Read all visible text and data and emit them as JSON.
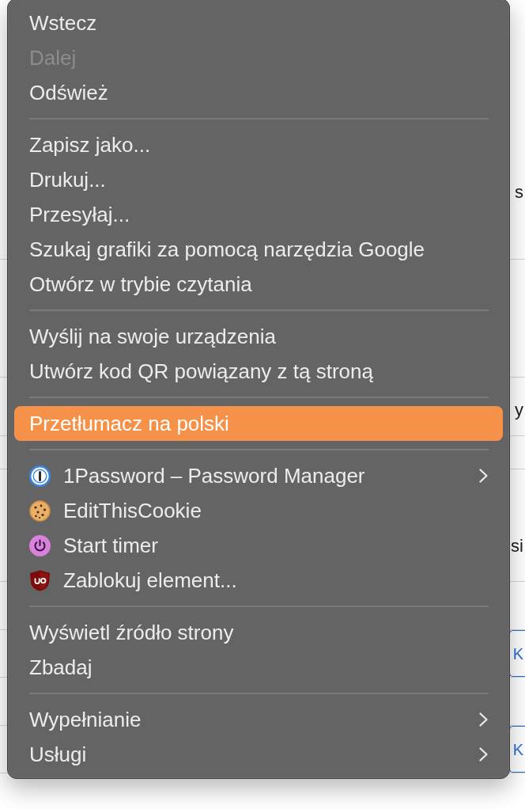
{
  "background_page": {
    "fragments": [
      {
        "text": "s",
        "kind": "text"
      },
      {
        "text": "y",
        "kind": "text"
      },
      {
        "text": "si",
        "kind": "text"
      },
      {
        "text": "K",
        "kind": "button"
      },
      {
        "text": "K",
        "kind": "button"
      }
    ]
  },
  "context_menu": {
    "groups": [
      {
        "items": [
          {
            "label": "Wstecz",
            "kind": "command",
            "disabled": false,
            "selected": false,
            "submenu": false
          },
          {
            "label": "Dalej",
            "kind": "command",
            "disabled": true,
            "selected": false,
            "submenu": false
          },
          {
            "label": "Odśwież",
            "kind": "command",
            "disabled": false,
            "selected": false,
            "submenu": false
          }
        ]
      },
      {
        "items": [
          {
            "label": "Zapisz jako...",
            "kind": "command",
            "disabled": false,
            "selected": false,
            "submenu": false
          },
          {
            "label": "Drukuj...",
            "kind": "command",
            "disabled": false,
            "selected": false,
            "submenu": false
          },
          {
            "label": "Przesyłaj...",
            "kind": "command",
            "disabled": false,
            "selected": false,
            "submenu": false
          },
          {
            "label": "Szukaj grafiki za pomocą narzędzia Google",
            "kind": "command",
            "disabled": false,
            "selected": false,
            "submenu": false
          },
          {
            "label": "Otwórz w trybie czytania",
            "kind": "command",
            "disabled": false,
            "selected": false,
            "submenu": false
          }
        ]
      },
      {
        "items": [
          {
            "label": "Wyślij na swoje urządzenia",
            "kind": "command",
            "disabled": false,
            "selected": false,
            "submenu": false
          },
          {
            "label": "Utwórz kod QR powiązany z tą stroną",
            "kind": "command",
            "disabled": false,
            "selected": false,
            "submenu": false
          }
        ]
      },
      {
        "items": [
          {
            "label": "Przetłumacz na polski",
            "kind": "command",
            "disabled": false,
            "selected": true,
            "submenu": false
          }
        ]
      },
      {
        "items": [
          {
            "label": "1Password – Password Manager",
            "kind": "extension",
            "disabled": false,
            "selected": false,
            "submenu": true
          },
          {
            "label": "EditThisCookie",
            "kind": "extension",
            "disabled": false,
            "selected": false,
            "submenu": false
          },
          {
            "label": "Start timer",
            "kind": "extension",
            "disabled": false,
            "selected": false,
            "submenu": false
          },
          {
            "label": "Zablokuj element...",
            "kind": "extension",
            "disabled": false,
            "selected": false,
            "submenu": false
          }
        ]
      },
      {
        "items": [
          {
            "label": "Wyświetl źródło strony",
            "kind": "command",
            "disabled": false,
            "selected": false,
            "submenu": false
          },
          {
            "label": "Zbadaj",
            "kind": "command",
            "disabled": false,
            "selected": false,
            "submenu": false
          }
        ]
      },
      {
        "items": [
          {
            "label": "Wypełnianie",
            "kind": "command",
            "disabled": false,
            "selected": false,
            "submenu": true
          },
          {
            "label": "Usługi",
            "kind": "command",
            "disabled": false,
            "selected": false,
            "submenu": true
          }
        ]
      }
    ]
  }
}
